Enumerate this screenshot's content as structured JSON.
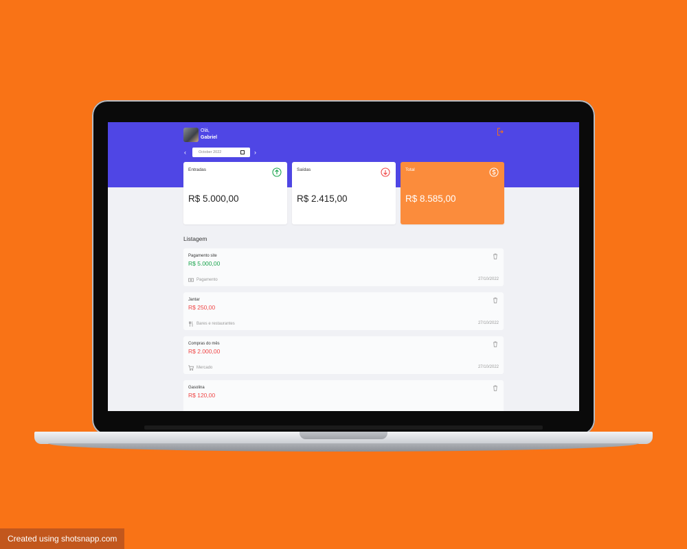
{
  "header": {
    "greeting": "Olá,",
    "user_name": "Gabriel",
    "month_value": "October 2022",
    "prev_glyph": "‹",
    "next_glyph": "›"
  },
  "cards": [
    {
      "label": "Entradas",
      "value": "R$ 5.000,00",
      "icon": "arrow-up-circle-icon",
      "color": "#16a34a"
    },
    {
      "label": "Saídas",
      "value": "R$ 2.415,00",
      "icon": "arrow-down-circle-icon",
      "color": "#ef4444"
    },
    {
      "label": "Total",
      "value": "R$ 8.585,00",
      "icon": "dollar-circle-icon",
      "color": "#ffffff"
    }
  ],
  "list": {
    "title": "Listagem",
    "items": [
      {
        "description": "Pagamento site",
        "amount": "R$ 5.000,00",
        "type": "income",
        "category": "Pagamento",
        "category_icon": "money-icon",
        "date": "27/10/2022"
      },
      {
        "description": "Jantar",
        "amount": "R$ 250,00",
        "type": "expense",
        "category": "Bares e restaurantes",
        "category_icon": "fork-knife-icon",
        "date": "27/10/2022"
      },
      {
        "description": "Compras do mês",
        "amount": "R$ 2.000,00",
        "type": "expense",
        "category": "Mercado",
        "category_icon": "cart-icon",
        "date": "27/10/2022"
      },
      {
        "description": "Gasolina",
        "amount": "R$ 120,00",
        "type": "expense",
        "category": "",
        "category_icon": "",
        "date": ""
      }
    ]
  },
  "colors": {
    "background": "#f97316",
    "header": "#4f46e5",
    "total_card": "#fb8c3c",
    "income": "#16a34a",
    "expense": "#ef4444"
  },
  "footer": {
    "watermark": "Created using shotsnapp.com"
  }
}
